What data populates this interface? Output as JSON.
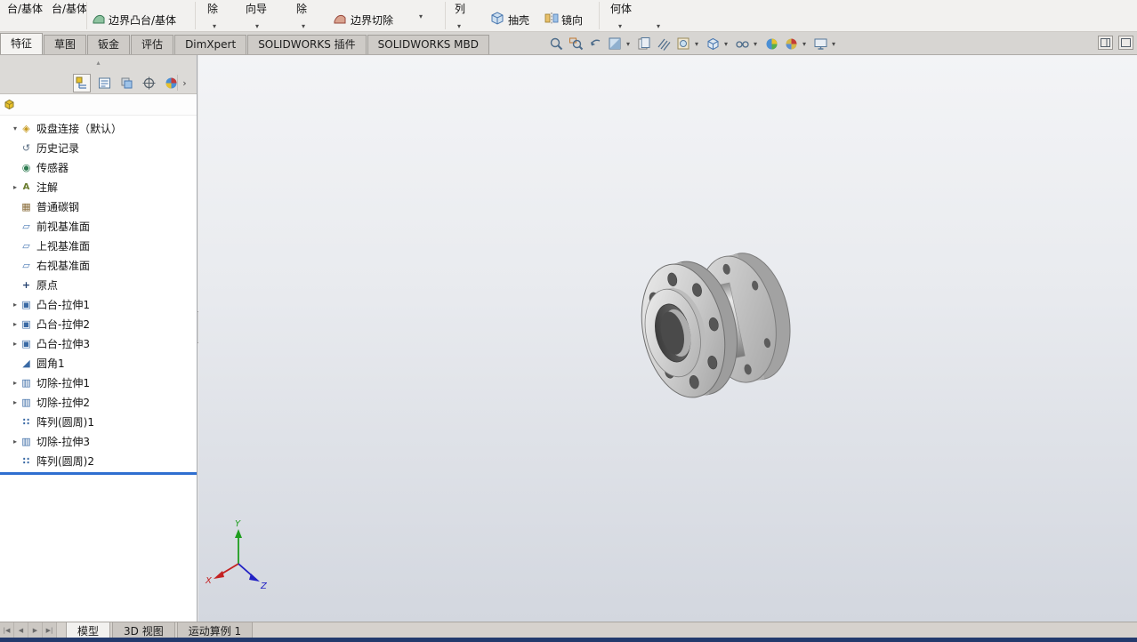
{
  "ribbon": {
    "buttons": [
      {
        "label": "台/基体",
        "name": "extruded-boss-base"
      },
      {
        "label": "台/基体",
        "name": "revolved-boss-base"
      },
      {
        "label": "边界凸台/基体",
        "name": "boundary-boss-base"
      },
      {
        "label": "除",
        "name": "extruded-cut"
      },
      {
        "label": "向导",
        "name": "hole-wizard"
      },
      {
        "label": "除",
        "name": "revolved-cut"
      },
      {
        "label": "边界切除",
        "name": "boundary-cut"
      },
      {
        "label": "列",
        "name": "pattern"
      },
      {
        "label": "抽壳",
        "name": "shell"
      },
      {
        "label": "镜向",
        "name": "mirror"
      },
      {
        "label": "何体",
        "name": "reference-geometry"
      }
    ]
  },
  "command_tabs": {
    "items": [
      {
        "label": "特征",
        "active": true
      },
      {
        "label": "草图"
      },
      {
        "label": "钣金"
      },
      {
        "label": "评估"
      },
      {
        "label": "DimXpert"
      },
      {
        "label": "SOLIDWORKS 插件"
      },
      {
        "label": "SOLIDWORKS MBD"
      }
    ]
  },
  "hud": {
    "icons": [
      "zoom-to-fit",
      "zoom-to-area",
      "previous-view",
      "section-view",
      "annotation-views",
      "hatch-measure",
      "appearance-ball",
      "display-style",
      "hide-show-items",
      "edit-appearance",
      "apply-scene",
      "view-settings"
    ]
  },
  "left_panel": {
    "tabs": [
      "feature-manager",
      "property-manager",
      "configuration-manager",
      "dimxpert-manager",
      "display-manager"
    ],
    "flyout": "›"
  },
  "feature_tree": {
    "items": [
      {
        "label": "吸盘连接（默认）",
        "icon": "part",
        "caret": "▾"
      },
      {
        "label": "历史记录",
        "icon": "history"
      },
      {
        "label": "传感器",
        "icon": "sensors"
      },
      {
        "label": "注解",
        "icon": "annotations",
        "caret": "▸"
      },
      {
        "label": "普通碳钢",
        "icon": "material"
      },
      {
        "label": "前视基准面",
        "icon": "plane"
      },
      {
        "label": "上视基准面",
        "icon": "plane"
      },
      {
        "label": "右视基准面",
        "icon": "plane"
      },
      {
        "label": "原点",
        "icon": "origin"
      },
      {
        "label": "凸台-拉伸1",
        "icon": "boss",
        "caret": "▸"
      },
      {
        "label": "凸台-拉伸2",
        "icon": "boss",
        "caret": "▸"
      },
      {
        "label": "凸台-拉伸3",
        "icon": "boss",
        "caret": "▸"
      },
      {
        "label": "圆角1",
        "icon": "fillet"
      },
      {
        "label": "切除-拉伸1",
        "icon": "cut",
        "caret": "▸"
      },
      {
        "label": "切除-拉伸2",
        "icon": "cut",
        "caret": "▸"
      },
      {
        "label": "阵列(圆周)1",
        "icon": "pattern"
      },
      {
        "label": "切除-拉伸3",
        "icon": "cut",
        "caret": "▸"
      },
      {
        "label": "阵列(圆周)2",
        "icon": "pattern"
      }
    ]
  },
  "bottom": {
    "nav": [
      {
        "glyph": "|◀"
      },
      {
        "glyph": "◀"
      },
      {
        "glyph": "▶"
      },
      {
        "glyph": "▶|"
      }
    ],
    "tabs": [
      {
        "label": "模型",
        "active": true
      },
      {
        "label": "3D 视图"
      },
      {
        "label": "运动算例 1"
      }
    ]
  },
  "triad": {
    "x": "X",
    "y": "Y",
    "z": "Z"
  },
  "colors": {
    "rollback": "#2f6fd0",
    "status_bar": "#233a6d",
    "viewport_top": "#f3f4f6",
    "viewport_bottom": "#d3d7df",
    "triad_x": "#c42222",
    "triad_y": "#1f9e1f",
    "triad_z": "#2222c4"
  }
}
